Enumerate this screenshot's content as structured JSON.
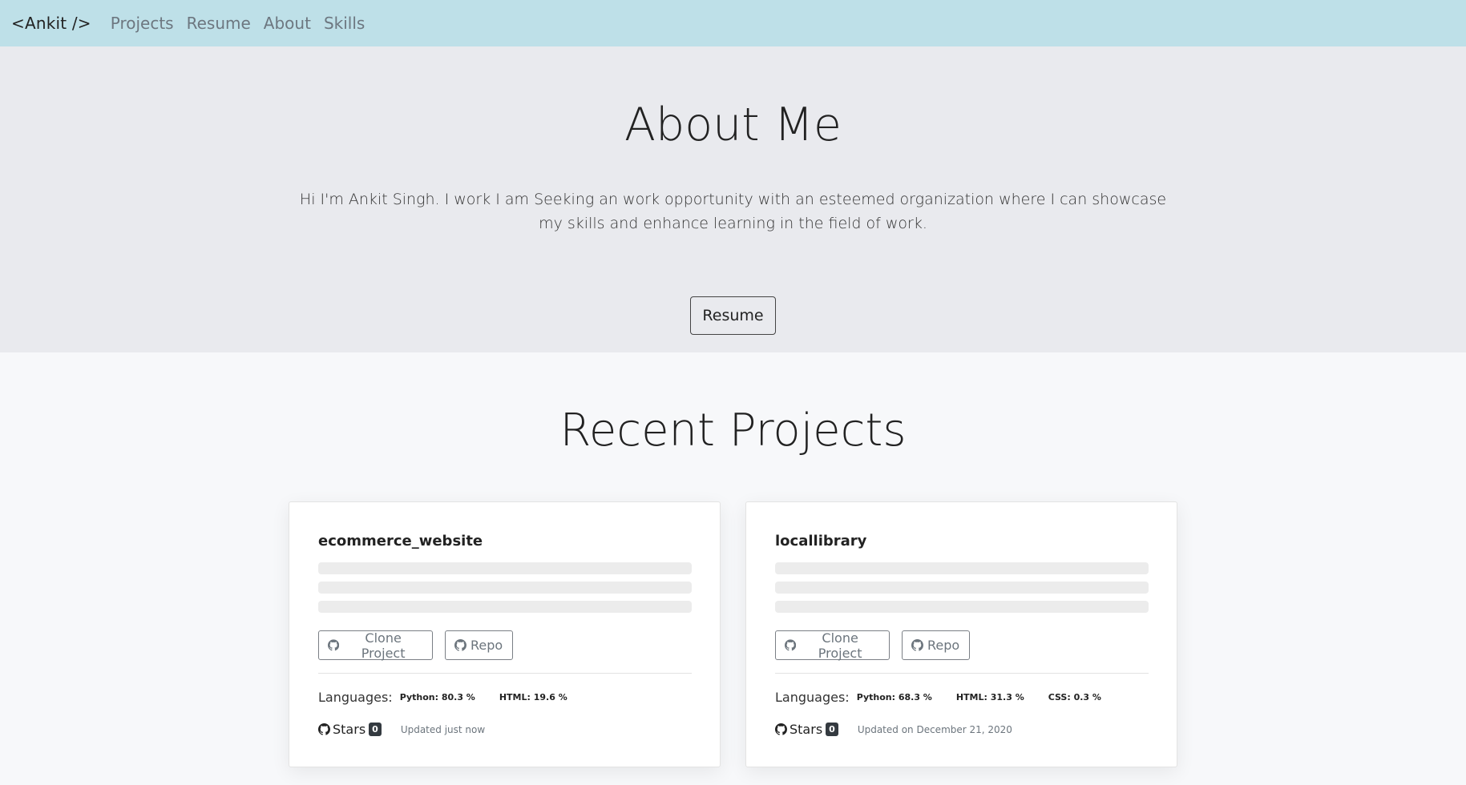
{
  "navbar": {
    "brand": "<Ankit />",
    "links": [
      "Projects",
      "Resume",
      "About",
      "Skills"
    ]
  },
  "hero": {
    "title": "About Me",
    "text": "Hi I'm Ankit Singh. I work I am Seeking an work opportunity with an esteemed organization where I can showcase my skills and enhance learning in the field of work.",
    "resume_label": "Resume"
  },
  "projects": {
    "title": "Recent Projects",
    "cards": [
      {
        "name": "ecommerce_website",
        "clone_label": "Clone Project",
        "repo_label": "Repo",
        "languages_label": "Languages:",
        "languages": [
          "Python: 80.3 %",
          "HTML: 19.6 %"
        ],
        "stars_label": "Stars",
        "stars": "0",
        "updated": "Updated just now"
      },
      {
        "name": "locallibrary",
        "clone_label": "Clone Project",
        "repo_label": "Repo",
        "languages_label": "Languages:",
        "languages": [
          "Python: 68.3 %",
          "HTML: 31.3 %",
          "CSS: 0.3 %"
        ],
        "stars_label": "Stars",
        "stars": "0",
        "updated": "Updated on December 21, 2020"
      }
    ]
  },
  "icons": {
    "github": "github-icon"
  },
  "colors": {
    "navbar_bg": "#bee0e8",
    "hero_bg": "#e9eaee",
    "page_bg": "#f7f8fa"
  }
}
